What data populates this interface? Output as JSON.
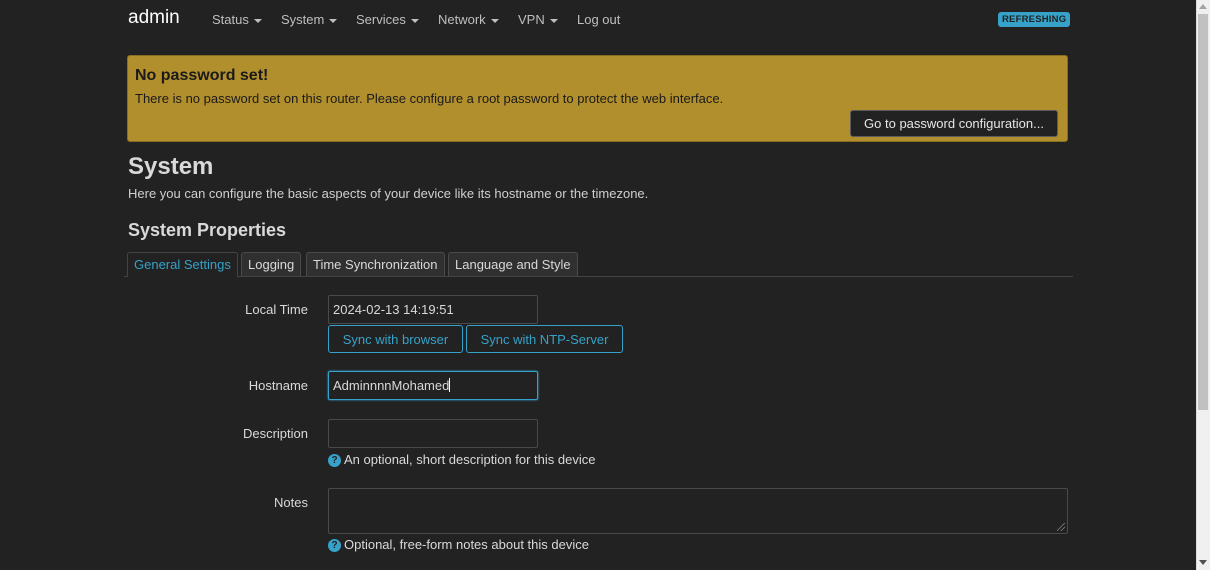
{
  "navbar": {
    "brand": "admin",
    "menu": [
      {
        "label": "Status",
        "has_dropdown": true
      },
      {
        "label": "System",
        "has_dropdown": true
      },
      {
        "label": "Services",
        "has_dropdown": true
      },
      {
        "label": "Network",
        "has_dropdown": true
      },
      {
        "label": "VPN",
        "has_dropdown": true
      },
      {
        "label": "Log out",
        "has_dropdown": false
      }
    ],
    "refresh_badge": "REFRESHING"
  },
  "alert": {
    "title": "No password set!",
    "message": "There is no password set on this router. Please configure a root password to protect the web interface.",
    "button": "Go to password configuration..."
  },
  "page": {
    "title": "System",
    "description": "Here you can configure the basic aspects of your device like its hostname or the timezone.",
    "section_title": "System Properties"
  },
  "tabs": [
    {
      "label": "General Settings",
      "active": true
    },
    {
      "label": "Logging",
      "active": false
    },
    {
      "label": "Time Synchronization",
      "active": false
    },
    {
      "label": "Language and Style",
      "active": false
    }
  ],
  "form": {
    "local_time": {
      "label": "Local Time",
      "value": "2024-02-13 14:19:51",
      "sync_browser_button": "Sync with browser",
      "sync_ntp_button": "Sync with NTP-Server"
    },
    "hostname": {
      "label": "Hostname",
      "value": "AdminnnnMohamed"
    },
    "description": {
      "label": "Description",
      "value": "",
      "hint": "An optional, short description for this device"
    },
    "notes": {
      "label": "Notes",
      "value": "",
      "hint": "Optional, free-form notes about this device"
    }
  },
  "icons": {
    "help": "help-circle-icon",
    "help_glyph": "?"
  },
  "colors": {
    "accent": "#36a2c9",
    "alert_bg": "#b28f2d",
    "background": "#222222"
  }
}
